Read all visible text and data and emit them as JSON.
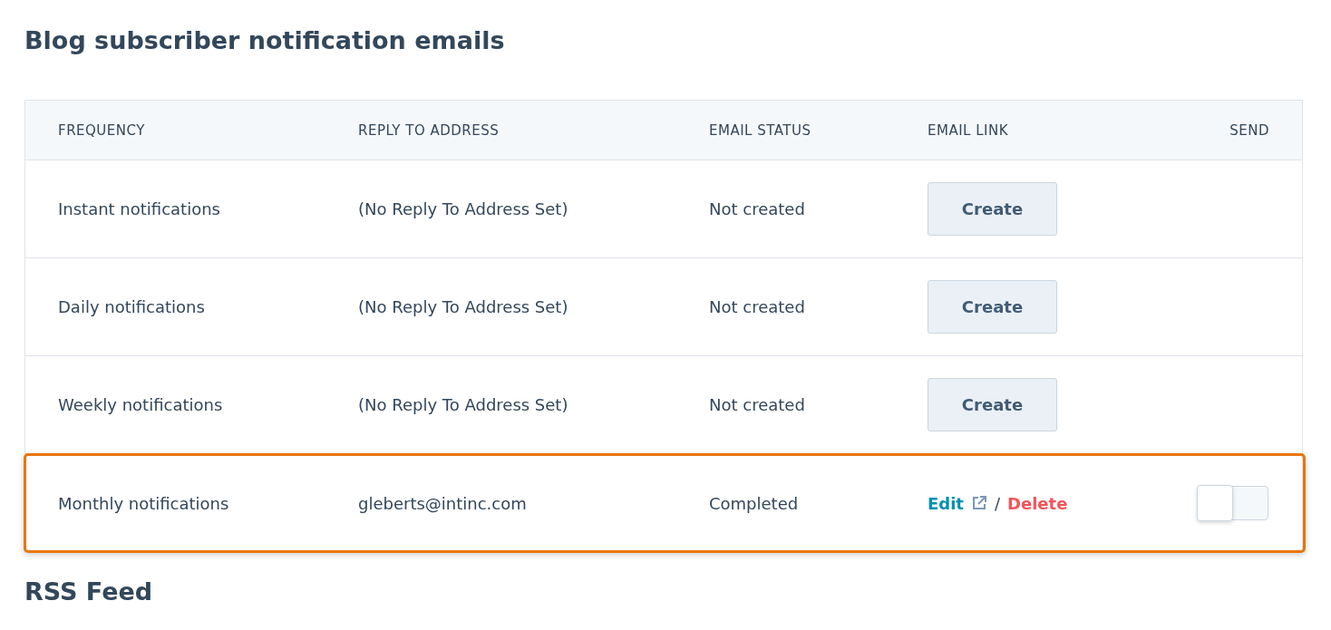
{
  "title": "Blog subscriber notification emails",
  "table": {
    "columns": [
      "FREQUENCY",
      "REPLY TO ADDRESS",
      "EMAIL STATUS",
      "EMAIL LINK",
      "SEND"
    ],
    "rows": [
      {
        "frequency": "Instant notifications",
        "reply_to": "(No Reply To Address Set)",
        "status": "Not created",
        "kind": "create",
        "button": "Create",
        "highlighted": false
      },
      {
        "frequency": "Daily notifications",
        "reply_to": "(No Reply To Address Set)",
        "status": "Not created",
        "kind": "create",
        "button": "Create",
        "highlighted": false
      },
      {
        "frequency": "Weekly notifications",
        "reply_to": "(No Reply To Address Set)",
        "status": "Not created",
        "kind": "create",
        "button": "Create",
        "highlighted": false
      },
      {
        "frequency": "Monthly notifications",
        "reply_to": "gleberts@intinc.com",
        "status": "Completed",
        "kind": "links",
        "edit": "Edit",
        "separator": "/",
        "delete": "Delete",
        "send_on": false,
        "highlighted": true
      }
    ]
  },
  "next_section": "RSS Feed"
}
